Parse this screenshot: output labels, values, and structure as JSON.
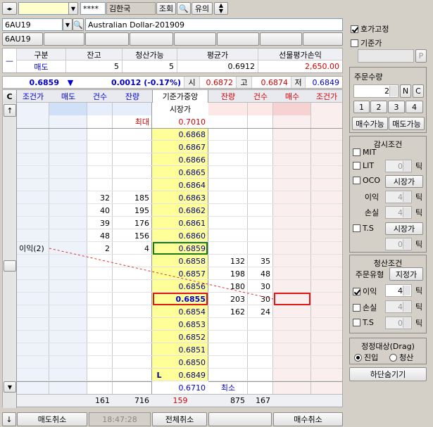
{
  "top": {
    "account_masked": "****",
    "user_name": "김한국",
    "query_btn": "조회",
    "notice_btn": "유의"
  },
  "symbol": {
    "code": "6AU19",
    "code2": "6AU19",
    "name": "Australian Dollar-201909"
  },
  "position": {
    "headers": [
      "구분",
      "잔고",
      "청산가능",
      "평균가",
      "선물평가손익"
    ],
    "side": "매도",
    "balance": "5",
    "closable": "5",
    "avg_price": "0.6912",
    "pnl": "2,650.00"
  },
  "quote": {
    "last": "0.6859",
    "arrow": "▼",
    "change": "0.0012 (-0.17%)",
    "open_label": "시",
    "open": "0.6872",
    "high_label": "고",
    "high": "0.6874",
    "low_label": "저",
    "low": "0.6849"
  },
  "grid": {
    "headers": [
      "C",
      "조건가",
      "매도",
      "건수",
      "잔량",
      "기준가중앙",
      "잔량",
      "건수",
      "매수",
      "조건가"
    ],
    "sub_header": "시장가",
    "max_label": "최대",
    "max_price": "0.7010",
    "min_label": "최소",
    "min_price": "0.6710",
    "rows": [
      {
        "cond": "",
        "sc": "",
        "sq": "",
        "price": "0.6868",
        "bq": "",
        "bc": ""
      },
      {
        "cond": "",
        "sc": "",
        "sq": "",
        "price": "0.6867",
        "bq": "",
        "bc": ""
      },
      {
        "cond": "",
        "sc": "",
        "sq": "",
        "price": "0.6866",
        "bq": "",
        "bc": ""
      },
      {
        "cond": "",
        "sc": "",
        "sq": "",
        "price": "0.6865",
        "bq": "",
        "bc": ""
      },
      {
        "cond": "",
        "sc": "",
        "sq": "",
        "price": "0.6864",
        "bq": "",
        "bc": ""
      },
      {
        "cond": "",
        "sc": "32",
        "sq": "185",
        "price": "0.6863",
        "bq": "",
        "bc": ""
      },
      {
        "cond": "",
        "sc": "40",
        "sq": "195",
        "price": "0.6862",
        "bq": "",
        "bc": ""
      },
      {
        "cond": "",
        "sc": "39",
        "sq": "176",
        "price": "0.6861",
        "bq": "",
        "bc": ""
      },
      {
        "cond": "",
        "sc": "48",
        "sq": "156",
        "price": "0.6860",
        "bq": "",
        "bc": ""
      },
      {
        "cond": "이익(2)",
        "sc": "2",
        "sq": "4",
        "price": "0.6859",
        "bq": "",
        "bc": ""
      },
      {
        "cond": "",
        "sc": "",
        "sq": "",
        "price": "0.6858",
        "bq": "132",
        "bc": "35"
      },
      {
        "cond": "",
        "sc": "",
        "sq": "",
        "price": "0.6857",
        "bq": "198",
        "bc": "48"
      },
      {
        "cond": "",
        "sc": "",
        "sq": "",
        "price": "0.6856",
        "bq": "180",
        "bc": "30"
      },
      {
        "cond": "",
        "sc": "",
        "sq": "",
        "price": "0.6855",
        "bq": "203",
        "bc": "30"
      },
      {
        "cond": "",
        "sc": "",
        "sq": "",
        "price": "0.6854",
        "bq": "162",
        "bc": "24"
      },
      {
        "cond": "",
        "sc": "",
        "sq": "",
        "price": "0.6853",
        "bq": "",
        "bc": ""
      },
      {
        "cond": "",
        "sc": "",
        "sq": "",
        "price": "0.6852",
        "bq": "",
        "bc": ""
      },
      {
        "cond": "",
        "sc": "",
        "sq": "",
        "price": "0.6851",
        "bq": "",
        "bc": ""
      },
      {
        "cond": "",
        "sc": "",
        "sq": "",
        "price": "0.6850",
        "bq": "",
        "bc": ""
      },
      {
        "cond": "",
        "sc": "",
        "sq": "",
        "price": "0.6849",
        "bq": "",
        "bc": ""
      }
    ],
    "low_marker": "L",
    "totals": {
      "sc": "161",
      "sq": "716",
      "center": "159",
      "bq": "875",
      "bc": "167"
    }
  },
  "bottom": {
    "cancel_sell": "매도취소",
    "time": "18:47:28",
    "cancel_all": "전체취소",
    "cancel_buy": "매수취소"
  },
  "side": {
    "fix_quote": "호가고정",
    "base_price": "기준가",
    "p_btn": "P",
    "order_qty_title": "주문수량",
    "order_qty": "2",
    "n_btn": "N",
    "c_btn": "C",
    "qty_presets": [
      "1",
      "2",
      "3",
      "4"
    ],
    "buy_avail": "매수가능",
    "sell_avail": "매도가능",
    "watch_title": "감시조건",
    "mit": "MIT",
    "lit": "LIT",
    "lit_val": "0",
    "tick": "틱",
    "oco": "OCO",
    "market_btn": "시장가",
    "profit": "이익",
    "loss": "손실",
    "oco_profit_val": "4",
    "oco_loss_val": "4",
    "ts": "T.S",
    "ts_val": "0",
    "close_title": "청산조건",
    "order_type": "주문유형",
    "limit_btn": "지정가",
    "close_profit_val": "4",
    "close_loss_val": "4",
    "close_ts_val": "0",
    "correct_title": "정정대상(Drag)",
    "entry": "진입",
    "exit": "청산",
    "hide_bottom": "하단숨기기"
  }
}
